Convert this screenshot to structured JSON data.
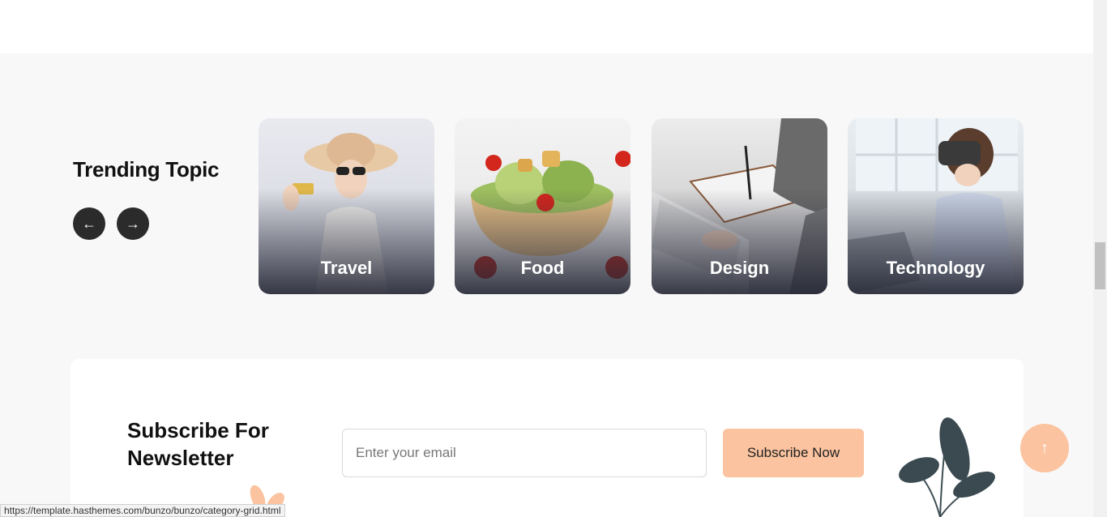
{
  "trending": {
    "title": "Trending Topic",
    "prev_icon": "arrow-left-icon",
    "next_icon": "arrow-right-icon",
    "cards": [
      {
        "label": "Travel"
      },
      {
        "label": "Food"
      },
      {
        "label": "Design"
      },
      {
        "label": "Technology"
      }
    ]
  },
  "newsletter": {
    "title": "Subscribe For Newsletter",
    "email_placeholder": "Enter your email",
    "button_label": "Subscribe Now"
  },
  "scroll_top_icon": "arrow-up-icon",
  "status_bar": {
    "url": "https://template.hasthemes.com/bunzo/bunzo/category-grid.html"
  },
  "colors": {
    "accent": "#fbc39f",
    "dark": "#2b2b2b",
    "section_bg": "#f8f8f9"
  }
}
